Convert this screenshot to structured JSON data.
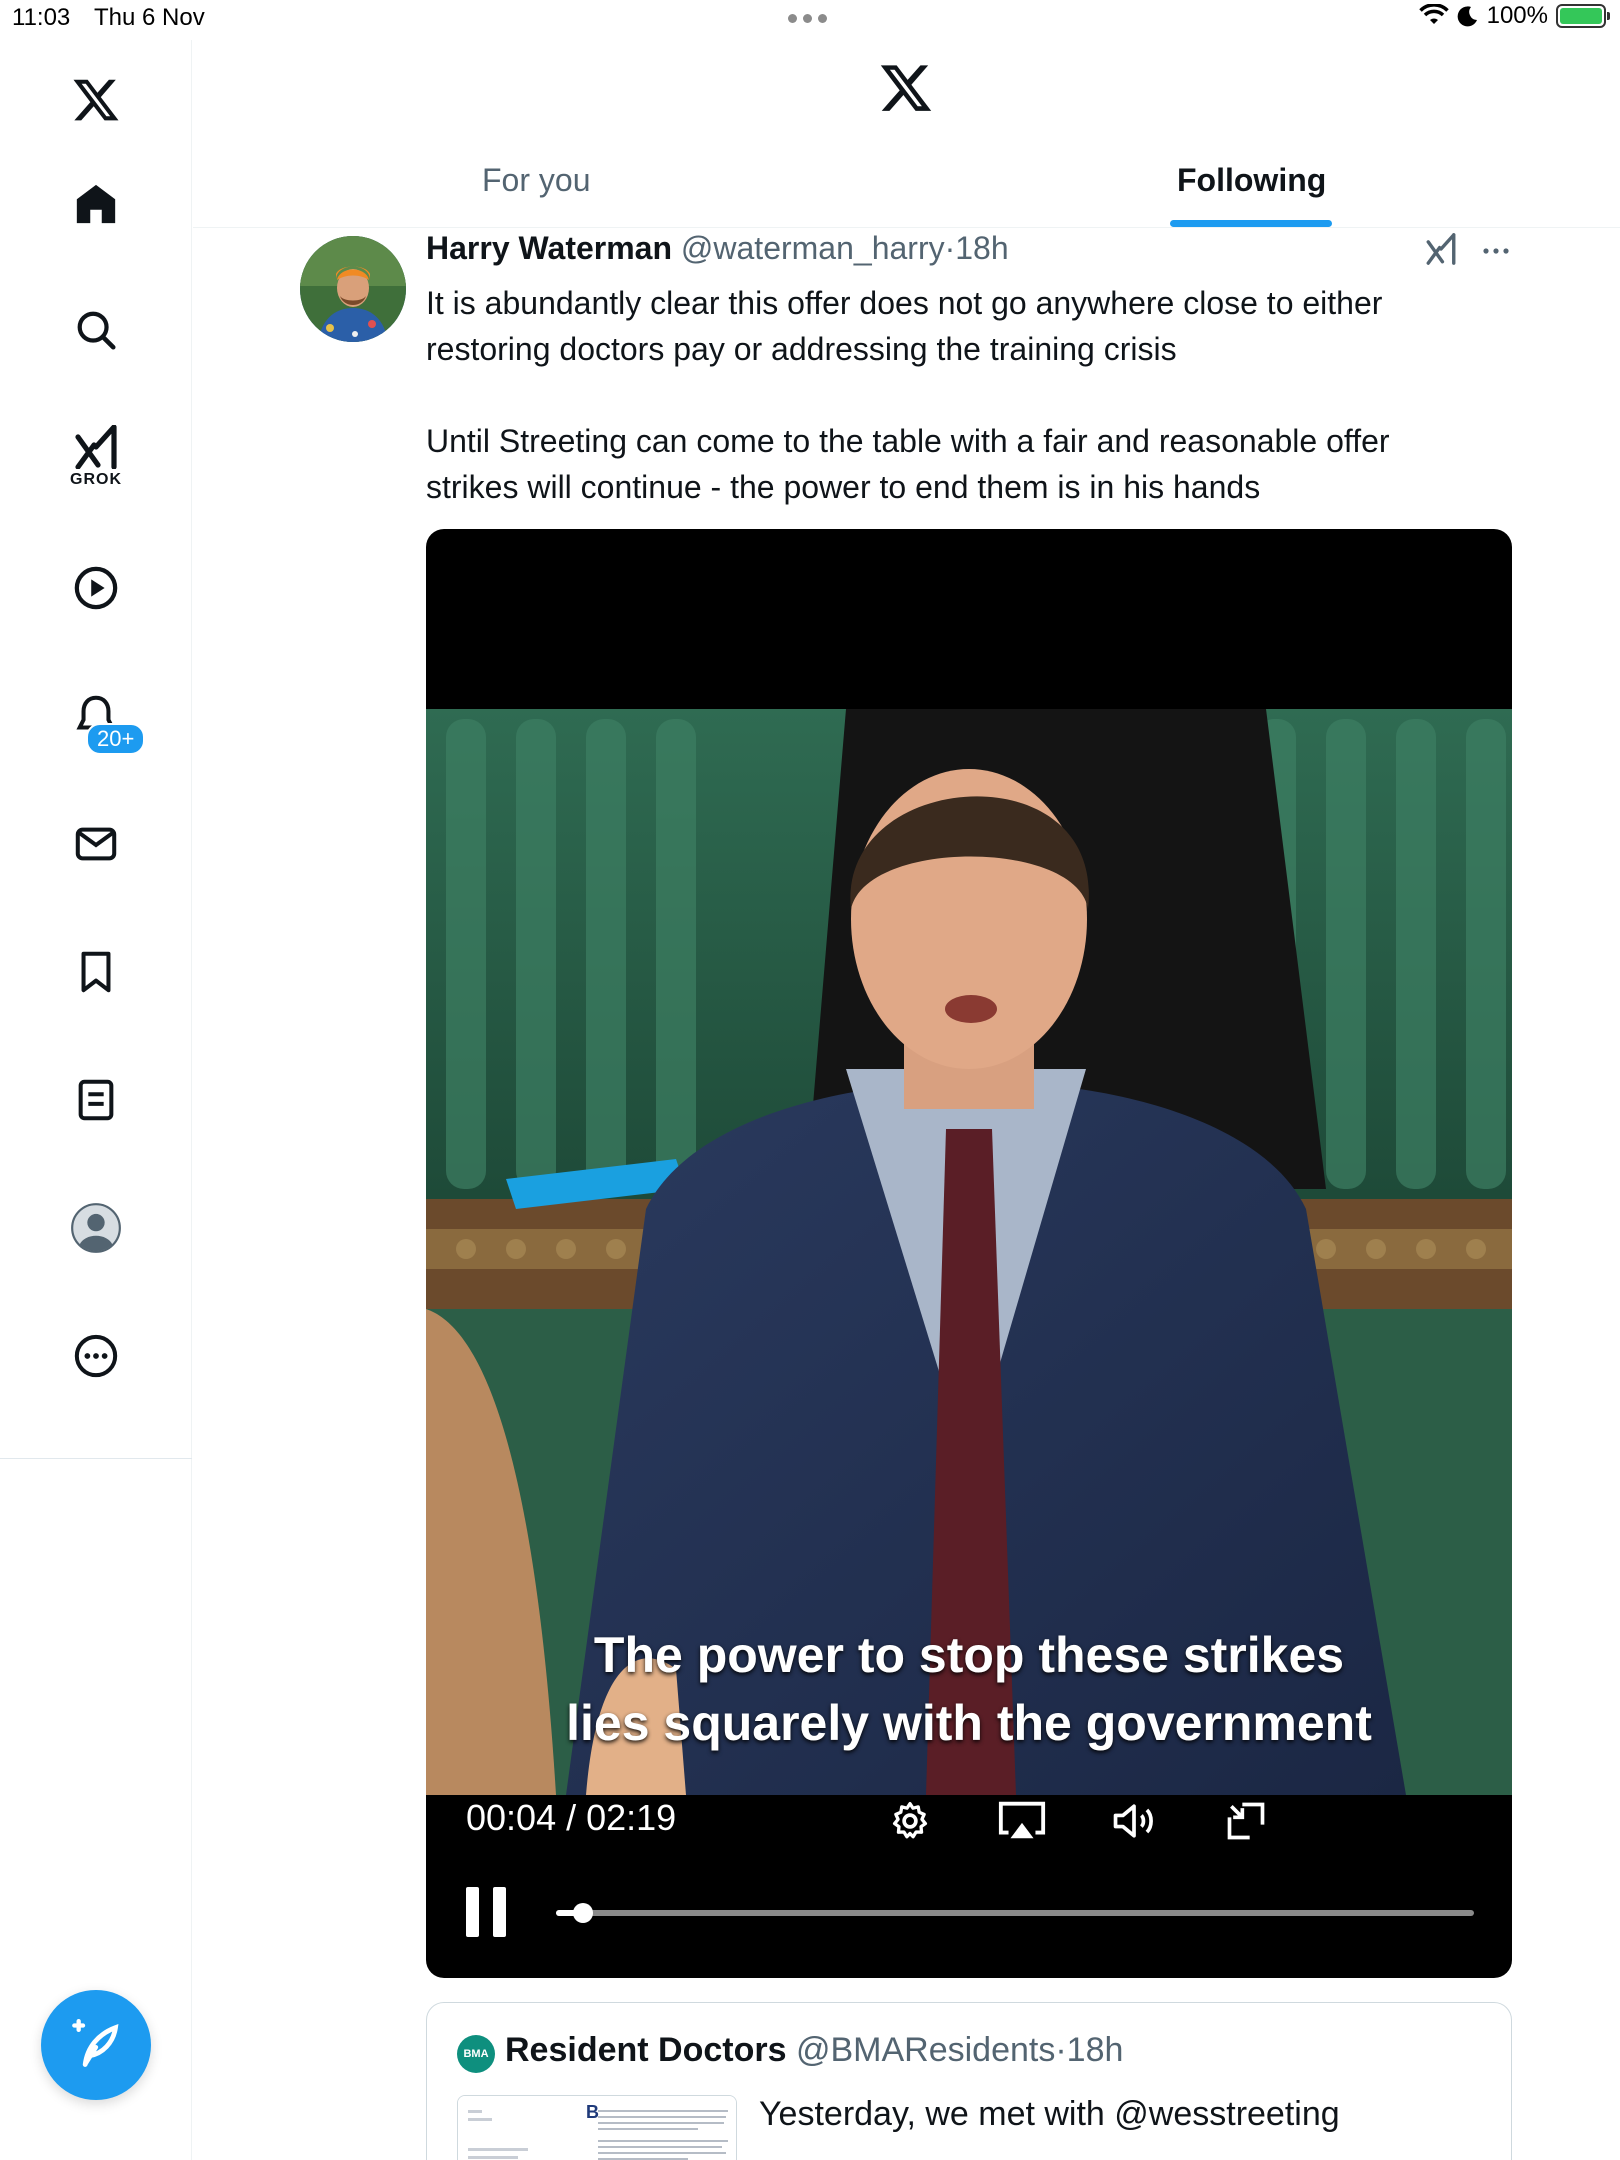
{
  "status_bar": {
    "time": "11:03",
    "date": "Thu 6 Nov",
    "battery_text": "100%",
    "battery_level": 1.0
  },
  "sidebar": {
    "items": [
      {
        "name": "x-logo",
        "icon": "x-logo-icon"
      },
      {
        "name": "home",
        "icon": "home-icon"
      },
      {
        "name": "search",
        "icon": "search-icon"
      },
      {
        "name": "grok",
        "icon": "grok-icon",
        "label": "GROK"
      },
      {
        "name": "video",
        "icon": "play-circle-icon"
      },
      {
        "name": "notifications",
        "icon": "bell-icon",
        "badge": "20+"
      },
      {
        "name": "messages",
        "icon": "mail-icon"
      },
      {
        "name": "bookmarks",
        "icon": "bookmark-icon"
      },
      {
        "name": "lists",
        "icon": "list-icon"
      },
      {
        "name": "profile",
        "icon": "profile-icon"
      },
      {
        "name": "more",
        "icon": "more-circle-icon"
      }
    ],
    "compose_icon": "compose-icon"
  },
  "header": {
    "tabs": [
      {
        "label": "For you",
        "active": false
      },
      {
        "label": "Following",
        "active": true
      }
    ]
  },
  "tweet": {
    "author_name": "Harry Waterman",
    "author_handle": "@waterman_harry",
    "separator": "·",
    "time": "18h",
    "text": "It is abundantly clear this offer does not go anywhere close to either\nrestoring doctors pay or addressing the training crisis\n\nUntil Streeting can come to the table with a fair and reasonable offer\nstrikes will continue - the power to end them is in his hands",
    "video": {
      "caption_line1": "The power to stop these strikes",
      "caption_line2": "lies squarely with the government",
      "time_display": "00:04 / 02:19",
      "progress": 0.029,
      "state": "playing",
      "controls": [
        "settings-icon",
        "airplay-icon",
        "volume-icon",
        "exit-fullscreen-icon"
      ]
    }
  },
  "quoted_tweet": {
    "avatar_text": "BMA",
    "author_name": "Resident Doctors",
    "author_handle": "@BMAResidents",
    "separator": "·",
    "time": "18h",
    "text": "Yesterday, we met with @wesstreeting",
    "thumb_letter": "B"
  },
  "colors": {
    "accent": "#1d9bf0",
    "text_primary": "#0f1419",
    "text_secondary": "#536471",
    "border": "#eff3f4"
  }
}
